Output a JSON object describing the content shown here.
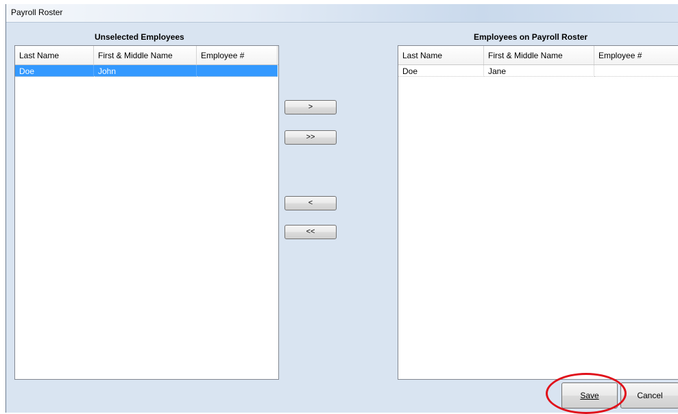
{
  "window": {
    "title": "Payroll Roster"
  },
  "left_panel": {
    "title": "Unselected Employees",
    "columns": [
      "Last Name",
      "First & Middle Name",
      "Employee #"
    ],
    "rows": [
      {
        "last": "Doe",
        "first": "John",
        "employee_no": ""
      }
    ]
  },
  "right_panel": {
    "title": "Employees on Payroll Roster",
    "columns": [
      "Last Name",
      "First & Middle Name",
      "Employee #"
    ],
    "rows": [
      {
        "last": "Doe",
        "first": "Jane",
        "employee_no": ""
      }
    ]
  },
  "move_buttons": {
    "add_one": ">",
    "add_all": ">>",
    "remove_one": "<",
    "remove_all": "<<"
  },
  "actions": {
    "save_label": "Save",
    "cancel_label": "Cancel"
  },
  "colors": {
    "selection": "#3399ff",
    "window_bg": "#d9e4f1",
    "highlight": "#e0101a"
  }
}
